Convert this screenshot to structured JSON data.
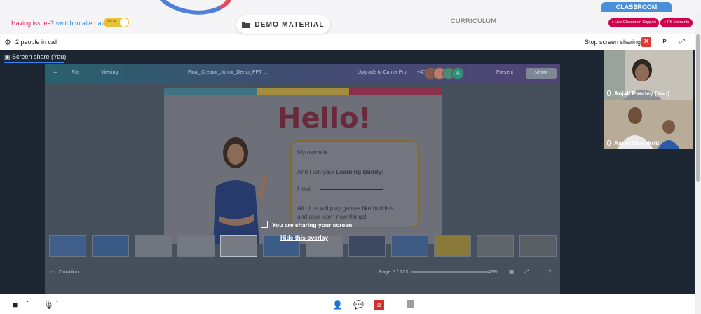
{
  "header": {
    "issues_text": "Having issues?",
    "switch_link": "switch to alternate room",
    "toggle_label": "INSTA",
    "demo_button": "DEMO MATERIAL",
    "curriculum": "CURRICULUM",
    "classroom_tab": "CLASSROOM",
    "live_support": "Live Classroom Support",
    "ps_moments": "PS Moments"
  },
  "call": {
    "people_count": "2 people in call",
    "stop_sharing": "Stop screen sharing",
    "p_label": "P",
    "share_tab": "Screen share (You)",
    "more": "···"
  },
  "canva": {
    "file": "File",
    "viewing": "Viewing",
    "doc_title": "Final_Creator_Junior_Demo_PPT ...",
    "upgrade": "Upgrade to Canva Pro",
    "plus_count": "+40",
    "avatar_letter": "A",
    "present": "Present",
    "share": "Share",
    "duration": "Duration",
    "page": "Page 5 / 123",
    "zoom": "43%"
  },
  "slide": {
    "hello": "Hello!",
    "line1": "My name is",
    "line2a": "And I am your",
    "line2b": "Learning Buddy",
    "line2c": "!",
    "line3": "I love",
    "line4": "All of us will play games like buddies",
    "line5": "and also learn new things!"
  },
  "overlay": {
    "sharing": "You are sharing your screen",
    "hide": "Hide this overlay"
  },
  "participants": [
    {
      "name": "Anjali Pandey (You)"
    },
    {
      "name": "Aarav Divyakriti"
    }
  ],
  "colors": {
    "accent": "#3b82f6",
    "danger": "#e53935",
    "brand_pink": "#d1004a",
    "classroom_blue": "#4a90d9"
  }
}
